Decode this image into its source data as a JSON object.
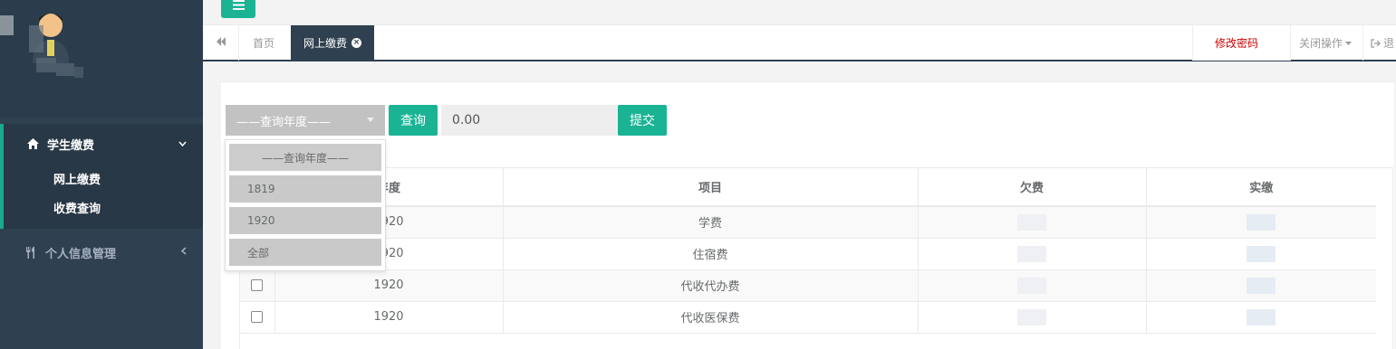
{
  "sidebar": {
    "groups": [
      {
        "label": "学生缴费",
        "icon": "home-icon",
        "items": [
          "网上缴费",
          "收费查询"
        ]
      },
      {
        "label": "个人信息管理",
        "icon": "cutlery-icon"
      }
    ]
  },
  "tabs": {
    "home": "首页",
    "active": "网上缴费",
    "change_password": "修改密码",
    "close_ops": "关闭操作",
    "exit": "退"
  },
  "form": {
    "year_select": "——查询年度——",
    "query_button": "查询",
    "amount_value": "0.00",
    "submit_button": "提交"
  },
  "dropdown": {
    "options": [
      "——查询年度——",
      "1819",
      "1920",
      "全部"
    ]
  },
  "table": {
    "headers": [
      "",
      "年度",
      "项目",
      "欠费",
      "实缴"
    ],
    "rows": [
      {
        "year": "1920",
        "item": "学费"
      },
      {
        "year": "1920",
        "item": "住宿费"
      },
      {
        "year": "1920",
        "item": "代收代办费"
      },
      {
        "year": "1920",
        "item": "代收医保费"
      }
    ]
  },
  "colors": {
    "sidebar": "#2f4050",
    "accent": "#1ab394",
    "danger": "#cc0000"
  }
}
